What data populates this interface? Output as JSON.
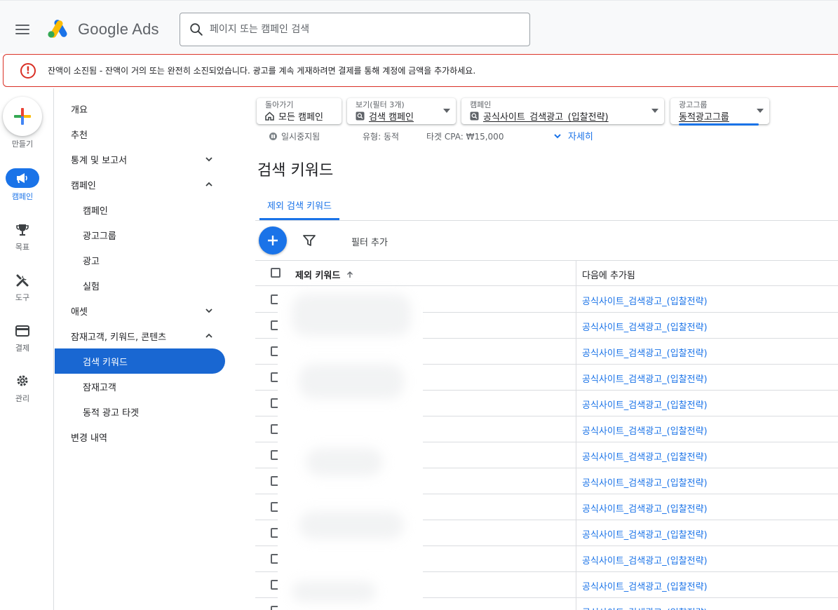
{
  "header": {
    "brand": "Google Ads",
    "search_placeholder": "페이지 또는 캠페인 검색"
  },
  "alert": {
    "message": "잔액이 소진됨 - 잔액이 거의 또는 완전히 소진되었습니다. 광고를 계속 게재하려면 결제를 통해 계정에 금액을 추가하세요."
  },
  "rail": {
    "create": "만들기",
    "campaign": "캠페인",
    "goals": "목표",
    "tools": "도구",
    "billing": "결제",
    "admin": "관리"
  },
  "nav": {
    "overview": "개요",
    "recommendations": "추천",
    "reports": "통계 및 보고서",
    "campaigns_group": "캠페인",
    "campaigns": "캠페인",
    "ad_groups": "광고그룹",
    "ads": "광고",
    "experiments": "실험",
    "assets": "애셋",
    "audiences_group": "잠재고객, 키워드, 콘텐츠",
    "search_keywords": "검색 키워드",
    "audiences": "잠재고객",
    "dynamic_targets": "동적 광고 타겟",
    "change_history": "변경 내역"
  },
  "chips": {
    "back_small": "돌아가기",
    "back_value": "모든 캠페인",
    "view_small": "보기(필터 3개)",
    "view_value": "검색 캠페인",
    "campaign_small": "캠페인",
    "campaign_value": "공식사이트_검색광고_(입찰전략)",
    "adgroup_small": "광고그룹",
    "adgroup_value": "동적광고그룹"
  },
  "meta": {
    "status": "일시중지됨",
    "type": "유형: 동적",
    "target": "타겟 CPA: ₩15,000",
    "details": "자세히"
  },
  "page": {
    "title": "검색 키워드",
    "tab": "제외 검색 키워드",
    "filter_add": "필터 추가"
  },
  "table": {
    "col1": "제외 키워드",
    "col2": "다음에 추가됨",
    "rows": [
      "공식사이트_검색광고_(입찰전략)",
      "공식사이트_검색광고_(입찰전략)",
      "공식사이트_검색광고_(입찰전략)",
      "공식사이트_검색광고_(입찰전략)",
      "공식사이트_검색광고_(입찰전략)",
      "공식사이트_검색광고_(입찰전략)",
      "공식사이트_검색광고_(입찰전략)",
      "공식사이트_검색광고_(입찰전략)",
      "공식사이트_검색광고_(입찰전략)",
      "공식사이트_검색광고_(입찰전략)",
      "공식사이트_검색광고_(입찰전략)",
      "공식사이트_검색광고_(입찰전략)",
      "공식사이트_검색광고_(입찰전략)"
    ]
  },
  "colors": {
    "primary": "#1a73e8",
    "active_nav": "#1967d2",
    "error": "#d93025"
  }
}
